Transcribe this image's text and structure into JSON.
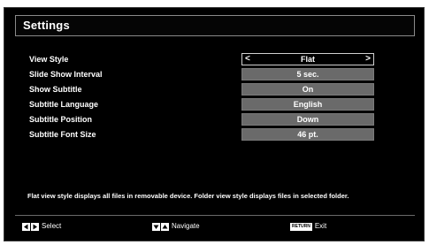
{
  "title": "Settings",
  "rows": [
    {
      "label": "View Style",
      "value": "Flat",
      "arrow_left": "<",
      "arrow_right": ">"
    },
    {
      "label": "Slide Show Interval",
      "value": "5 sec."
    },
    {
      "label": "Show Subtitle",
      "value": "On"
    },
    {
      "label": "Subtitle Language",
      "value": "English"
    },
    {
      "label": "Subtitle Position",
      "value": "Down"
    },
    {
      "label": "Subtitle Font Size",
      "value": "46 pt."
    }
  ],
  "help_text": "Flat view style displays all files in removable device. Folder view style displays files in selected folder.",
  "legend": {
    "select_icons": [
      "arrow-left-icon",
      "arrow-right-icon"
    ],
    "select_label": "Select",
    "navigate_icons": [
      "arrow-down-icon",
      "arrow-up-icon"
    ],
    "navigate_label": "Navigate",
    "return_key_label": "RETURN",
    "exit_label": "Exit"
  },
  "colors": {
    "background": "#000000",
    "value_box": "#6a6a6a",
    "selected_border": "#d0d0d0",
    "text": "#ffffff"
  }
}
